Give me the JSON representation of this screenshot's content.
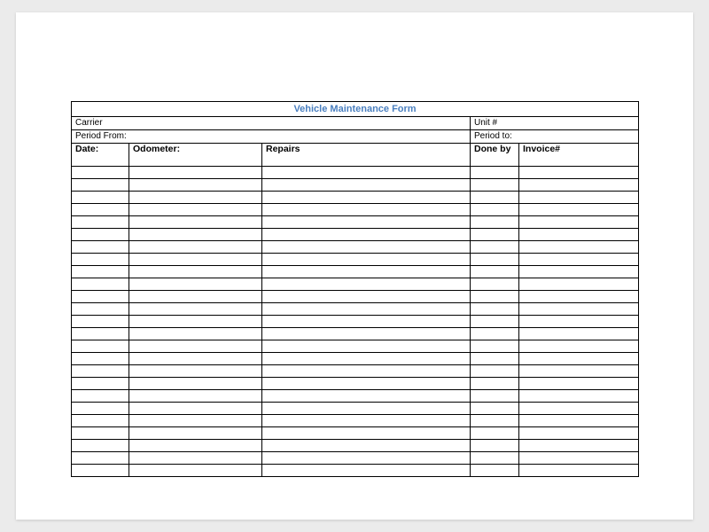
{
  "form": {
    "title": "Vehicle Maintenance Form",
    "carrier_label": "Carrier",
    "unit_label": "Unit #",
    "period_from_label": "Period From:",
    "period_to_label": "Period to:",
    "columns": {
      "date": "Date:",
      "odometer": "Odometer:",
      "repairs": "Repairs",
      "done_by": "Done by",
      "invoice": "Invoice#"
    },
    "blank_row_count": 25
  }
}
